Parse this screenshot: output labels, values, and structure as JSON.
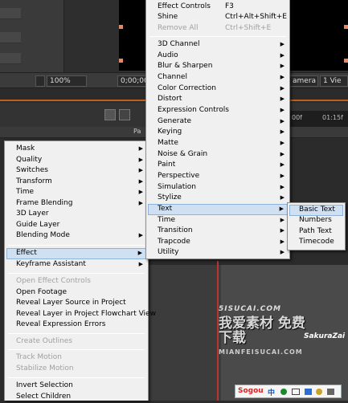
{
  "viewer_bar": {
    "zoom": "100%",
    "timecode": "0;00;00",
    "camera": "amera",
    "views": "1 Vie"
  },
  "timeline": {
    "col_label": "Pa",
    "ruler_left": "00f",
    "ruler_right": "01:15f"
  },
  "layer_menu": {
    "items": [
      {
        "label": "Mask",
        "submenu": true
      },
      {
        "label": "Quality",
        "submenu": true
      },
      {
        "label": "Switches",
        "submenu": true
      },
      {
        "label": "Transform",
        "submenu": true
      },
      {
        "label": "Time",
        "submenu": true
      },
      {
        "label": "Frame Blending",
        "submenu": true
      },
      {
        "label": "3D Layer"
      },
      {
        "label": "Guide Layer"
      },
      {
        "label": "Blending Mode",
        "submenu": true
      },
      {
        "label": "Effect",
        "submenu": true,
        "highlighted": true
      },
      {
        "label": "Keyframe Assistant",
        "submenu": true
      },
      {
        "label": "Open Effect Controls",
        "disabled": true
      },
      {
        "label": "Open Footage"
      },
      {
        "label": "Reveal Layer Source in Project"
      },
      {
        "label": "Reveal Layer in Project Flowchart View"
      },
      {
        "label": "Reveal Expression Errors"
      },
      {
        "label": "Create Outlines",
        "disabled": true
      },
      {
        "label": "Track Motion",
        "disabled": true
      },
      {
        "label": "Stabilize Motion",
        "disabled": true
      },
      {
        "label": "Invert Selection"
      },
      {
        "label": "Select Children"
      }
    ]
  },
  "effect_menu": {
    "items": [
      {
        "label": "Effect Controls",
        "shortcut": "F3"
      },
      {
        "label": "Shine",
        "shortcut": "Ctrl+Alt+Shift+E"
      },
      {
        "label": "Remove All",
        "shortcut": "Ctrl+Shift+E",
        "disabled": true
      },
      {
        "label": "3D Channel",
        "submenu": true
      },
      {
        "label": "Audio",
        "submenu": true
      },
      {
        "label": "Blur & Sharpen",
        "submenu": true
      },
      {
        "label": "Channel",
        "submenu": true
      },
      {
        "label": "Color Correction",
        "submenu": true
      },
      {
        "label": "Distort",
        "submenu": true
      },
      {
        "label": "Expression Controls",
        "submenu": true
      },
      {
        "label": "Generate",
        "submenu": true
      },
      {
        "label": "Keying",
        "submenu": true
      },
      {
        "label": "Matte",
        "submenu": true
      },
      {
        "label": "Noise & Grain",
        "submenu": true
      },
      {
        "label": "Paint",
        "submenu": true
      },
      {
        "label": "Perspective",
        "submenu": true
      },
      {
        "label": "Simulation",
        "submenu": true
      },
      {
        "label": "Stylize",
        "submenu": true
      },
      {
        "label": "Text",
        "submenu": true,
        "highlighted": true
      },
      {
        "label": "Time",
        "submenu": true
      },
      {
        "label": "Transition",
        "submenu": true
      },
      {
        "label": "Trapcode",
        "submenu": true
      },
      {
        "label": "Utility",
        "submenu": true
      }
    ]
  },
  "text_menu": {
    "items": [
      {
        "label": "Basic Text",
        "highlighted": true
      },
      {
        "label": "Numbers"
      },
      {
        "label": "Path Text"
      },
      {
        "label": "Timecode"
      }
    ]
  },
  "watermark": {
    "top": "5ISUCAI.COM",
    "cn": "我爱素材 免费下载",
    "brand": "SakuraZai",
    "bottom": "MIANFEISUCAI.COM"
  },
  "ime_bar": {
    "brand": "Sogou",
    "mode": "中"
  },
  "colors": {
    "menu_bg": "#f0f0f0",
    "highlight": "#cfe0f3",
    "accent_orange": "#c1601c",
    "cti_red": "#b33333"
  }
}
